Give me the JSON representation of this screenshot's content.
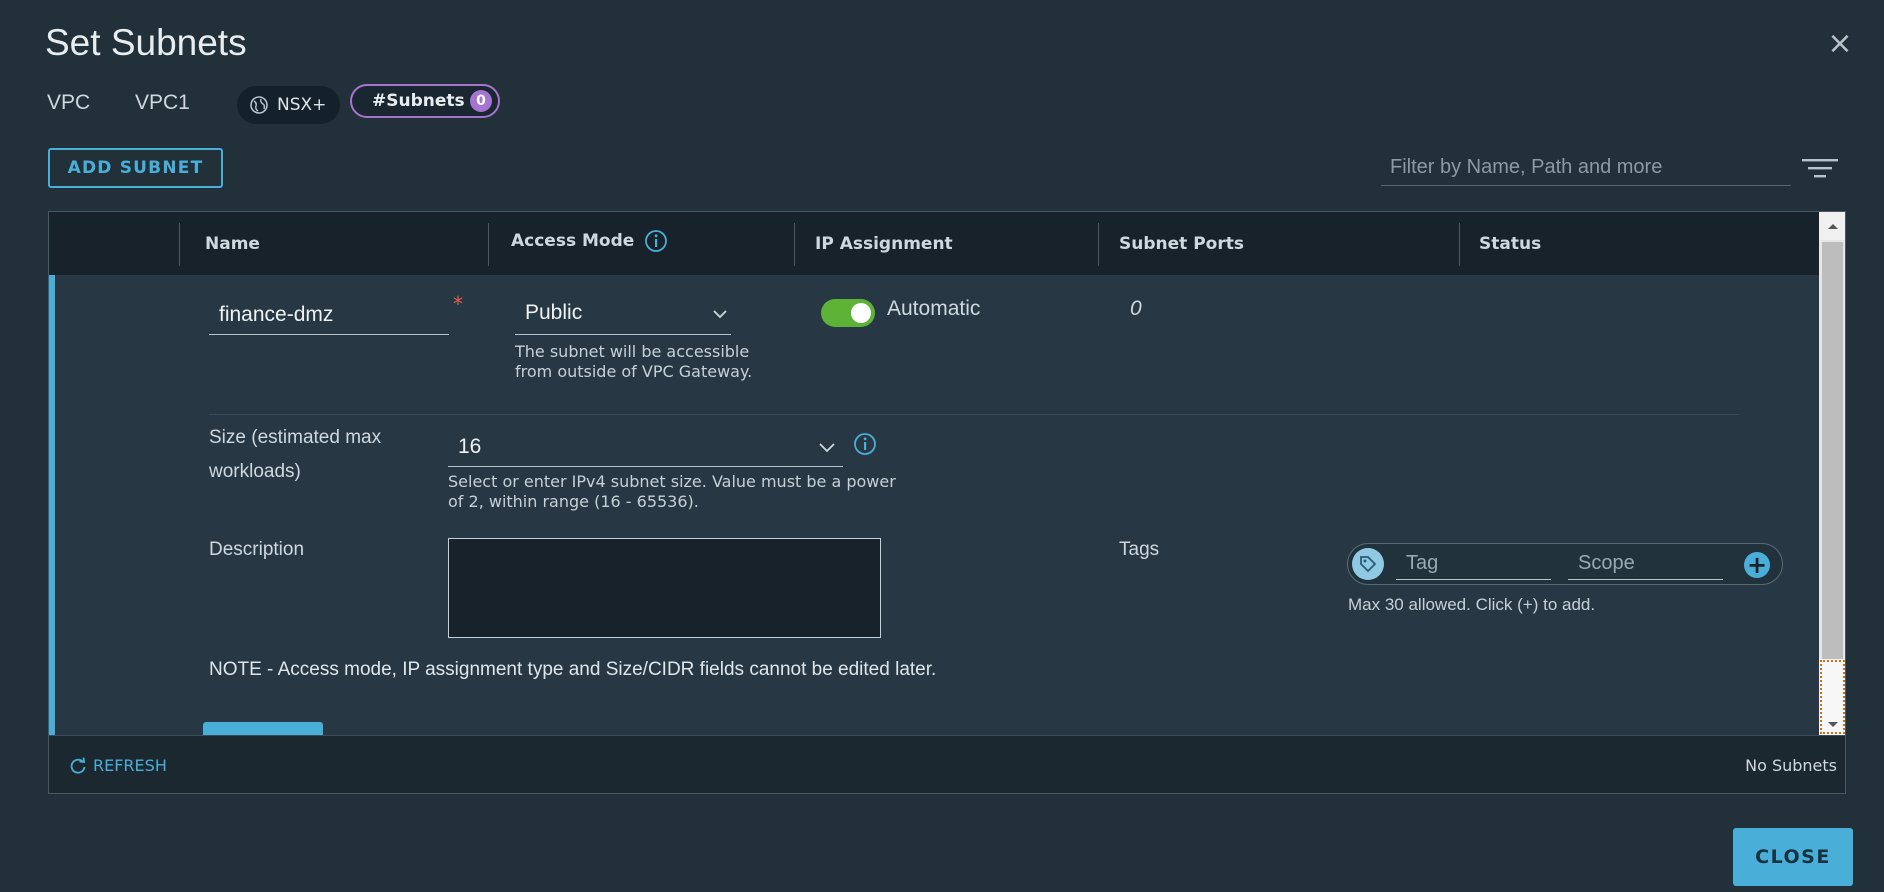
{
  "dialog": {
    "title": "Set Subnets",
    "close_icon": "close-icon"
  },
  "context": {
    "label": "VPC",
    "value": "VPC1",
    "nsx_chip": "NSX+",
    "subnets_chip_label": "#Subnets",
    "subnets_count": "0"
  },
  "toolbar": {
    "add_subnet": "ADD SUBNET",
    "filter_placeholder": "Filter by Name, Path and more"
  },
  "grid": {
    "columns": [
      "Name",
      "Access Mode",
      "IP Assignment",
      "Subnet Ports",
      "Status"
    ],
    "row": {
      "name": "finance-dmz",
      "access_mode": "Public",
      "access_help": "The subnet will be accessible from outside of VPC Gateway.",
      "ip_assignment": "Automatic",
      "ip_assignment_on": true,
      "subnet_ports": "0",
      "size_label": "Size (estimated max workloads)",
      "size_value": "16",
      "size_help": "Select or enter IPv4 subnet size. Value must be a power of 2, within range (16 - 65536).",
      "description_label": "Description",
      "description_value": "",
      "tags_label": "Tags",
      "tag_placeholder": "Tag",
      "scope_placeholder": "Scope",
      "tags_help": "Max 30 allowed. Click (+) to add.",
      "note": "NOTE - Access mode, IP assignment type and Size/CIDR fields cannot be edited later."
    },
    "footer": {
      "refresh": "REFRESH",
      "status": "No Subnets"
    }
  },
  "actions": {
    "close": "CLOSE"
  },
  "colors": {
    "accent": "#49afd9",
    "toggle_on": "#5eb236",
    "chip_purple": "#a574d0",
    "required": "#e35d4b"
  }
}
